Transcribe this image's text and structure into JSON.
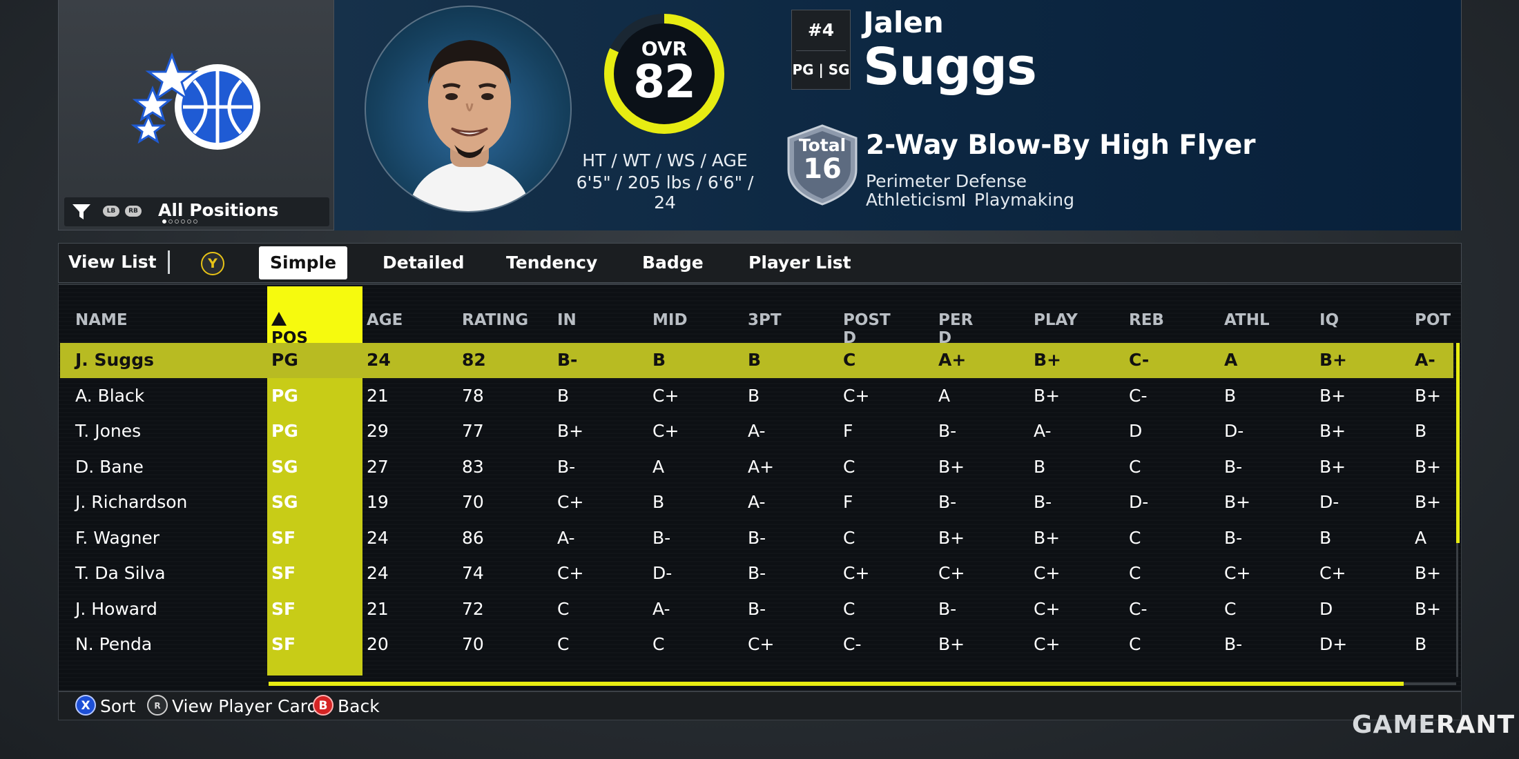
{
  "team_panel": {
    "logo": "magic-stars-basketball-logo",
    "filter": {
      "label": "All Positions",
      "lb": "LB",
      "rb": "RB",
      "page_dots": 6,
      "active_dot": 0
    }
  },
  "player": {
    "ovr_label": "OVR",
    "ovr": "82",
    "ovr_fraction": 0.82,
    "bio_label": "HT / WT / WS / AGE",
    "bio_value": "6'5\" / 205 lbs / 6'6\" / 24",
    "number": "#4",
    "positions": "PG | SG",
    "first_name": "Jalen",
    "last_name": "Suggs",
    "total_label": "Total",
    "total_value": "16",
    "archetype": "2-Way Blow-By High Flyer",
    "skills": [
      "Perimeter Defense",
      "Athleticism",
      "Playmaking"
    ]
  },
  "tabs": {
    "view_list": "View List",
    "y_button": "Y",
    "items": [
      {
        "label": "Simple",
        "active": true
      },
      {
        "label": "Detailed",
        "active": false
      },
      {
        "label": "Tendency",
        "active": false
      },
      {
        "label": "Badge",
        "active": false
      },
      {
        "label": "Player List",
        "active": false
      }
    ]
  },
  "table": {
    "columns": [
      "NAME",
      "POS",
      "AGE",
      "RATING",
      "IN",
      "MID",
      "3PT",
      "POST D",
      "PER D",
      "PLAY",
      "REB",
      "ATHL",
      "IQ",
      "POT"
    ],
    "sorted_column": "POS",
    "rows": [
      [
        "J. Suggs",
        "PG",
        "24",
        "82",
        "B-",
        "B",
        "B",
        "C",
        "A+",
        "B+",
        "C-",
        "A",
        "B+",
        "A-"
      ],
      [
        "A. Black",
        "PG",
        "21",
        "78",
        "B",
        "C+",
        "B",
        "C+",
        "A",
        "B+",
        "C-",
        "B",
        "B+",
        "B+"
      ],
      [
        "T. Jones",
        "PG",
        "29",
        "77",
        "B+",
        "C+",
        "A-",
        "F",
        "B-",
        "A-",
        "D",
        "D-",
        "B+",
        "B"
      ],
      [
        "D. Bane",
        "SG",
        "27",
        "83",
        "B-",
        "A",
        "A+",
        "C",
        "B+",
        "B",
        "C",
        "B-",
        "B+",
        "B+"
      ],
      [
        "J. Richardson",
        "SG",
        "19",
        "70",
        "C+",
        "B",
        "A-",
        "F",
        "B-",
        "B-",
        "D-",
        "B+",
        "D-",
        "B+"
      ],
      [
        "F. Wagner",
        "SF",
        "24",
        "86",
        "A-",
        "B-",
        "B-",
        "C",
        "B+",
        "B+",
        "C",
        "B-",
        "B",
        "A"
      ],
      [
        "T. Da Silva",
        "SF",
        "24",
        "74",
        "C+",
        "D-",
        "B-",
        "C+",
        "C+",
        "C+",
        "C",
        "C+",
        "C+",
        "B+"
      ],
      [
        "J. Howard",
        "SF",
        "21",
        "72",
        "C",
        "A-",
        "B-",
        "C",
        "B-",
        "C+",
        "C-",
        "C",
        "D",
        "B+"
      ],
      [
        "N. Penda",
        "SF",
        "20",
        "70",
        "C",
        "C",
        "C+",
        "C-",
        "B+",
        "C+",
        "C",
        "B-",
        "D+",
        "B"
      ]
    ],
    "selected_row": 0
  },
  "footer": {
    "sort_btn": "X",
    "sort": "Sort",
    "card_btn": "R",
    "card": "View Player Card",
    "back_btn": "B",
    "back": "Back"
  },
  "watermark": {
    "left": "GAME",
    "right": "RANT"
  },
  "colors": {
    "accent_yellow": "#e7ec12",
    "selected_row": "#b8bb22",
    "panel_blue": "#0d2843"
  }
}
